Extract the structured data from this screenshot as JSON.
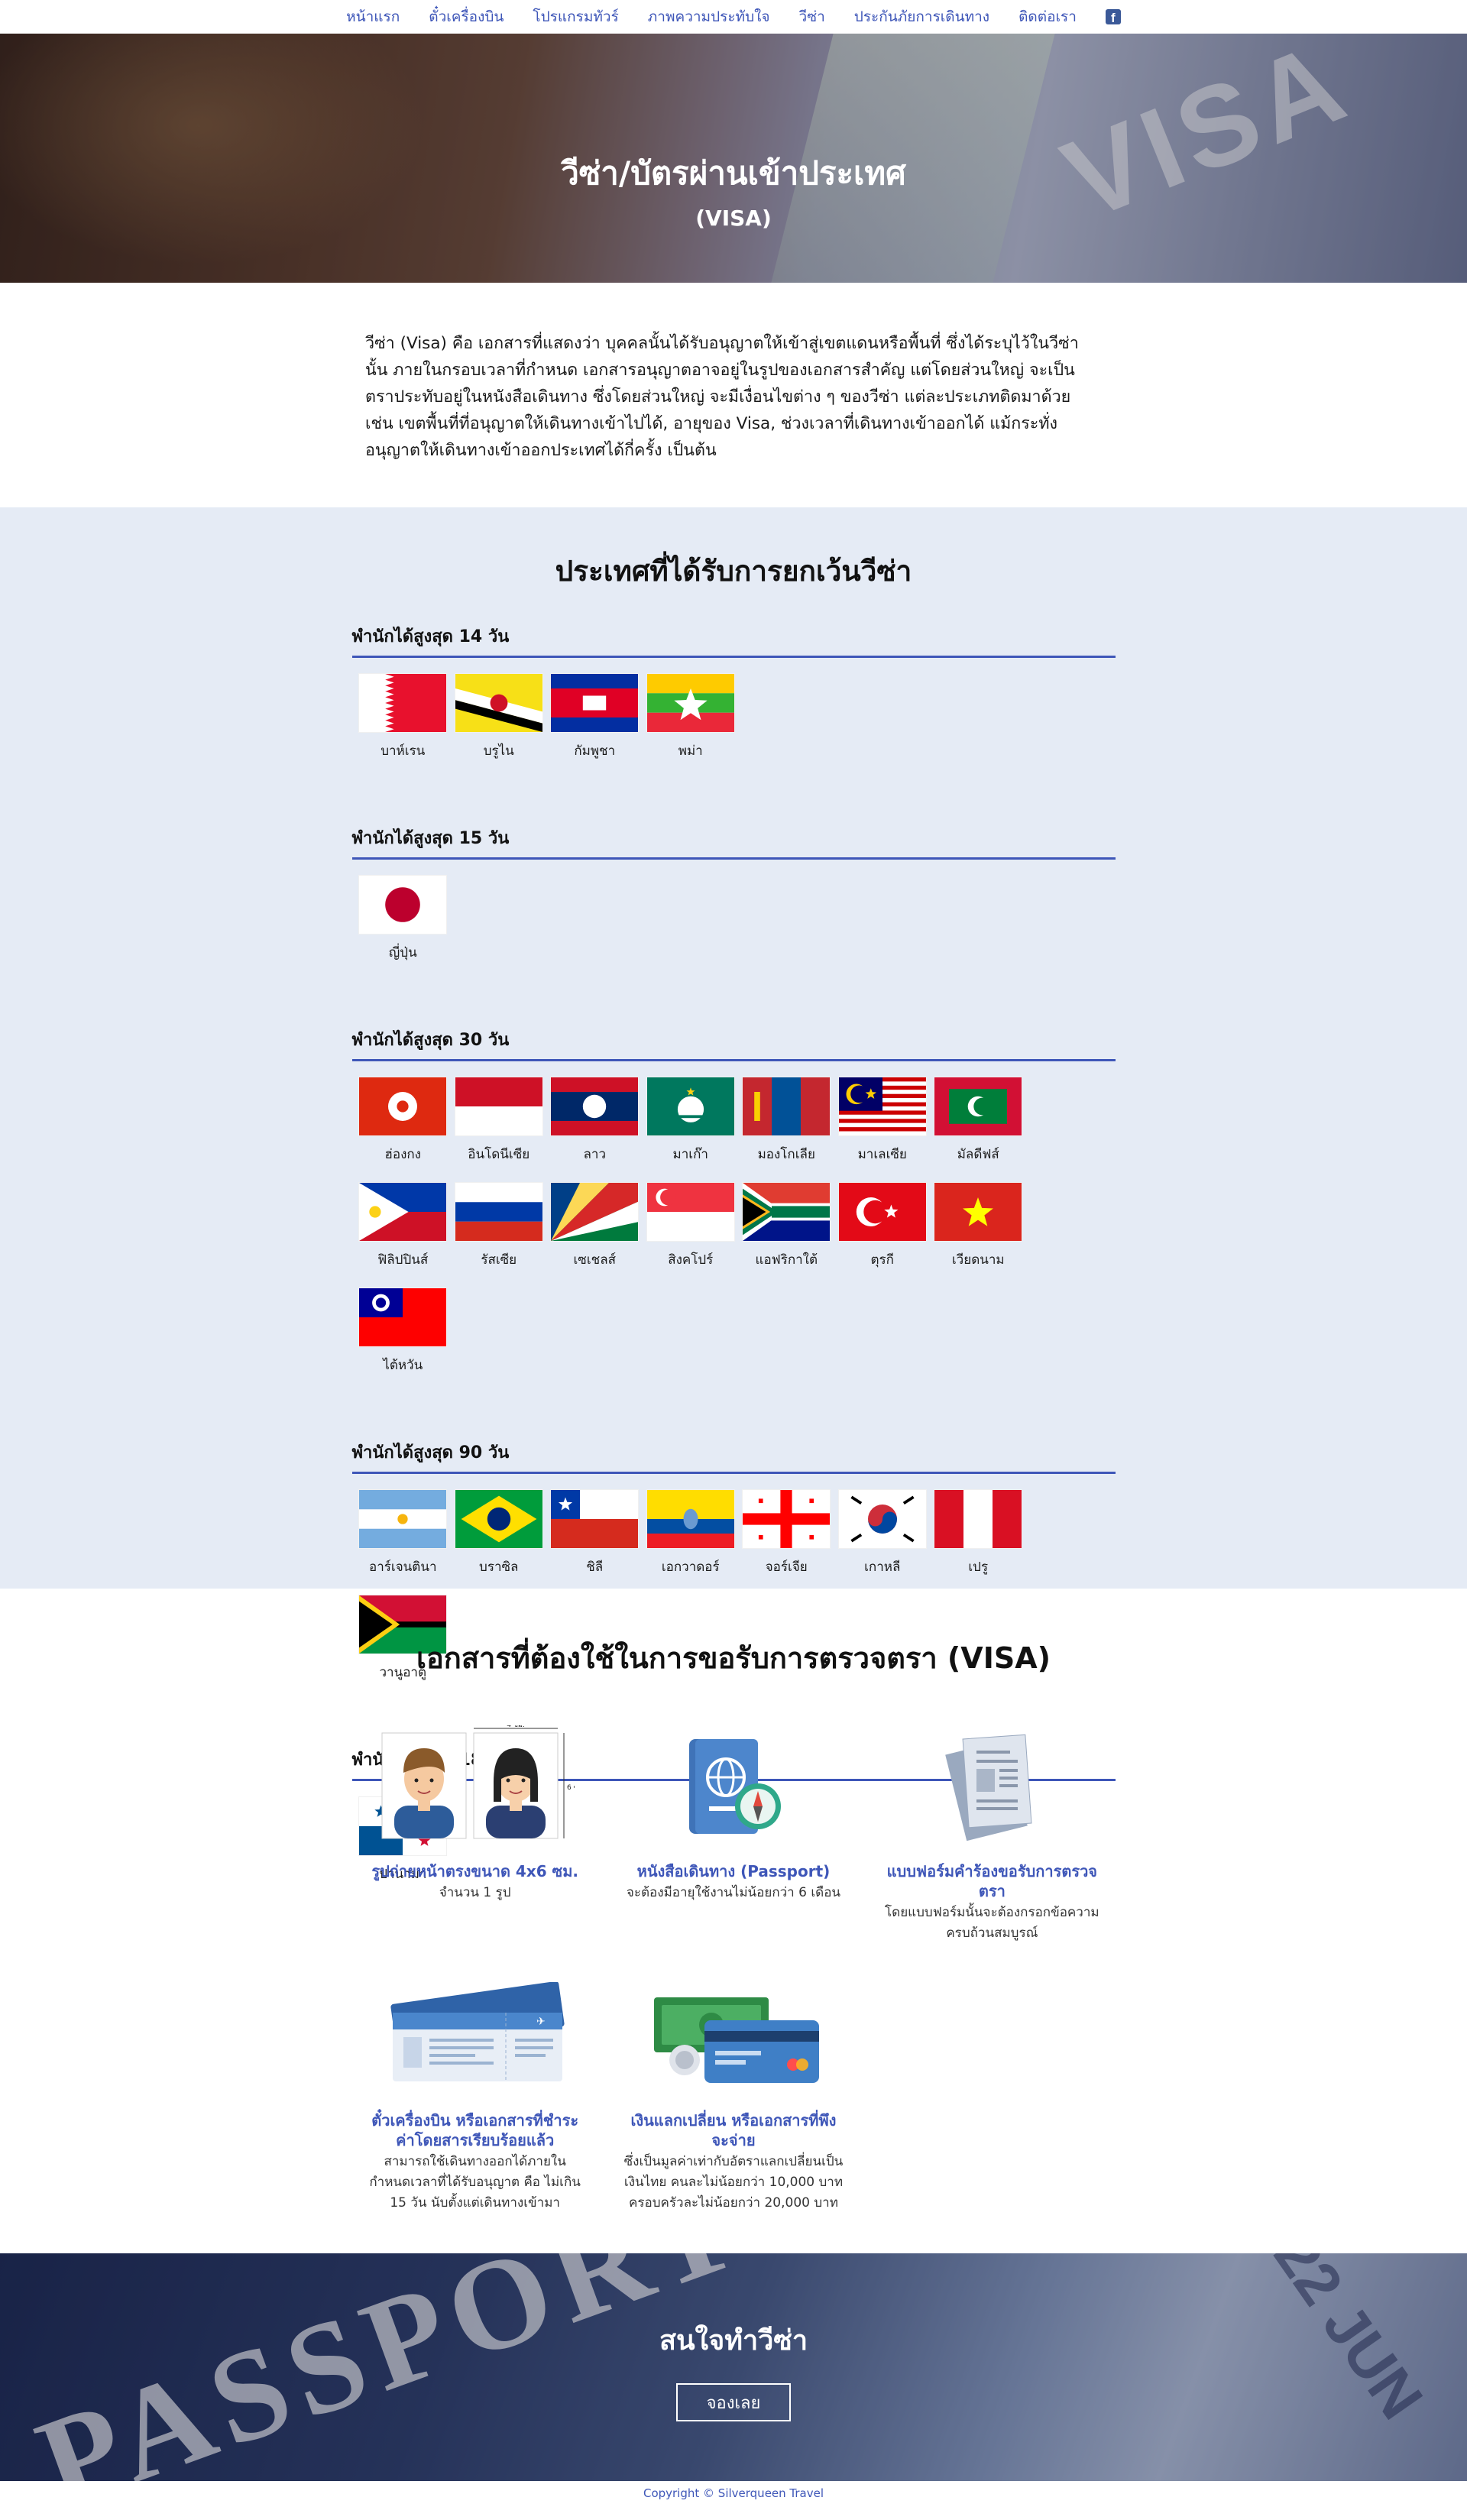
{
  "nav": {
    "items": [
      "หน้าแรก",
      "ตั๋วเครื่องบิน",
      "โปรแกรมทัวร์",
      "ภาพความประทับใจ",
      "วีซ่า",
      "ประกันภัยการเดินทาง",
      "ติดต่อเรา"
    ],
    "facebook_icon": "facebook-icon"
  },
  "hero": {
    "title": "วีซ่า/บัตรผ่านเข้าประเทศ",
    "subtitle": "(VISA)",
    "stamp_text": "VISA"
  },
  "intro": {
    "text": "วีซ่า (Visa) คือ เอกสารที่แสดงว่า บุคคลนั้นได้รับอนุญาตให้เข้าสู่เขตแดนหรือพื้นที่ ซึ่งได้ระบุไว้ในวีซ่านั้น ภายในกรอบเวลาที่กำหนด เอกสารอนุญาตอาจอยู่ในรูปของเอกสารสำคัญ แต่โดยส่วนใหญ่ จะเป็นตราประทับอยู่ในหนังสือเดินทาง ซึ่งโดยส่วนใหญ่ จะมีเงื่อนไขต่าง ๆ ของวีซ่า แต่ละประเภทติดมาด้วย เช่น เขตพื้นที่ที่อนุญาตให้เดินทางเข้าไปได้, อายุของ Visa, ช่วงเวลาที่เดินทางเข้าออกได้ แม้กระทั่งอนุญาตให้เดินทางเข้าออกประเทศได้กี่ครั้ง เป็นต้น"
  },
  "visa_free": {
    "title": "ประเทศที่ได้รับการยกเว้นวีซ่า",
    "groups": [
      {
        "heading": "พำนักได้สูงสุด 14 วัน",
        "countries": [
          {
            "name": "บาห์เรน",
            "flag": "bahrain"
          },
          {
            "name": "บรูไน",
            "flag": "brunei"
          },
          {
            "name": "กัมพูชา",
            "flag": "cambodia"
          },
          {
            "name": "พม่า",
            "flag": "myanmar"
          }
        ]
      },
      {
        "heading": "พำนักได้สูงสุด 15 วัน",
        "countries": [
          {
            "name": "ญี่ปุ่น",
            "flag": "japan"
          }
        ]
      },
      {
        "heading": "พำนักได้สูงสุด 30 วัน",
        "countries": [
          {
            "name": "ฮ่องกง",
            "flag": "hongkong"
          },
          {
            "name": "อินโดนีเซีย",
            "flag": "indonesia"
          },
          {
            "name": "ลาว",
            "flag": "laos"
          },
          {
            "name": "มาเก๊า",
            "flag": "macao"
          },
          {
            "name": "มองโกเลีย",
            "flag": "mongolia"
          },
          {
            "name": "มาเลเซีย",
            "flag": "malaysia"
          },
          {
            "name": "มัลดีฟส์",
            "flag": "maldives"
          },
          {
            "name": "ฟิลิปปินส์",
            "flag": "philippines"
          },
          {
            "name": "รัสเซีย",
            "flag": "russia"
          },
          {
            "name": "เซเชลส์",
            "flag": "seychelles"
          },
          {
            "name": "สิงคโปร์",
            "flag": "singapore"
          },
          {
            "name": "แอฟริกาใต้",
            "flag": "southafrica"
          },
          {
            "name": "ตุรกี",
            "flag": "turkey"
          },
          {
            "name": "เวียดนาม",
            "flag": "vietnam"
          },
          {
            "name": "ไต้หวัน",
            "flag": "taiwan"
          }
        ]
      },
      {
        "heading": "พำนักได้สูงสุด 90 วัน",
        "countries": [
          {
            "name": "อาร์เจนตินา",
            "flag": "argentina"
          },
          {
            "name": "บราซิล",
            "flag": "brazil"
          },
          {
            "name": "ชิลี",
            "flag": "chile"
          },
          {
            "name": "เอกวาดอร์",
            "flag": "ecuador"
          },
          {
            "name": "จอร์เจีย",
            "flag": "georgia"
          },
          {
            "name": "เกาหลี",
            "flag": "korea"
          },
          {
            "name": "เปรู",
            "flag": "peru"
          },
          {
            "name": "วานูอาตู",
            "flag": "vanuatu"
          }
        ]
      },
      {
        "heading": "พำนักได้สูงสุด 180 วัน",
        "countries": [
          {
            "name": "ปานามา",
            "flag": "panama"
          }
        ]
      }
    ]
  },
  "documents": {
    "title": "เอกสารที่ต้องใช้ในการขอรับการตรวจตรา (VISA)",
    "photo_size_label": "4 ซม.",
    "photo_height_label": "6 ซม.",
    "items": [
      {
        "icon": "photo-id-icon",
        "title": "รูปถ่ายหน้าตรงขนาด 4x6 ซม.",
        "desc": "จำนวน 1 รูป"
      },
      {
        "icon": "passport-icon",
        "title": "หนังสือเดินทาง (Passport)",
        "desc": "จะต้องมีอายุใช้งานไม่น้อยกว่า 6 เดือน"
      },
      {
        "icon": "form-icon",
        "title": "แบบฟอร์มคำร้องขอรับการตรวจตรา",
        "desc": "โดยแบบฟอร์มนั้นจะต้องกรอกข้อความครบถ้วนสมบูรณ์"
      },
      {
        "icon": "ticket-icon",
        "title": "ตั๋วเครื่องบิน หรือเอกสารที่ชำระค่าโดยสารเรียบร้อยแล้ว",
        "desc": "สามารถใช้เดินทางออกได้ภายในกำหนดเวลาที่ได้รับอนุญาต คือ ไม่เกิน 15 วัน นับตั้งแต่เดินทางเข้ามา"
      },
      {
        "icon": "money-icon",
        "title": "เงินแลกเปลี่ยน หรือเอกสารที่พึงจะจ่าย",
        "desc": "ซึ่งเป็นมูลค่าเท่ากับอัตราแลกเปลี่ยนเป็นเงินไทย คนละไม่น้อยกว่า 10,000 บาท ครอบครัวละไม่น้อยกว่า 20,000 บาท"
      }
    ]
  },
  "cta": {
    "title": "สนใจทำวีซ่า",
    "button": "จองเลย",
    "bg_text": "PASSPORT",
    "bg_date": "22 JUN"
  },
  "footer": {
    "text": "Copyright © Silverqueen Travel"
  },
  "colors": {
    "accent": "#3e56b8",
    "section_bg": "#e5ebf5"
  }
}
